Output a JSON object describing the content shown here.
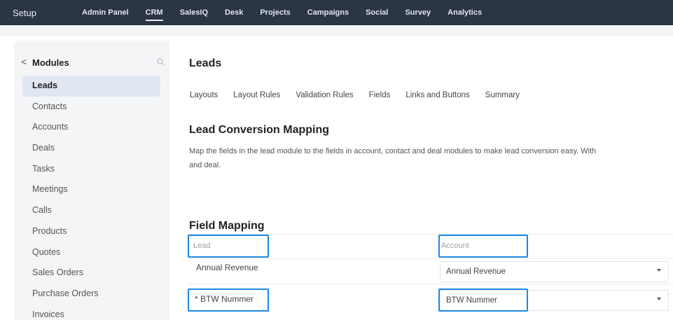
{
  "topbar": {
    "setup_label": "Setup",
    "nav": [
      {
        "label": "Admin Panel",
        "active": false
      },
      {
        "label": "CRM",
        "active": true
      },
      {
        "label": "SalesIQ",
        "active": false
      },
      {
        "label": "Desk",
        "active": false
      },
      {
        "label": "Projects",
        "active": false
      },
      {
        "label": "Campaigns",
        "active": false
      },
      {
        "label": "Social",
        "active": false
      },
      {
        "label": "Survey",
        "active": false
      },
      {
        "label": "Analytics",
        "active": false
      }
    ]
  },
  "sidebar": {
    "back_glyph": "<",
    "title": "Modules",
    "search_icon": "search-icon",
    "items": [
      {
        "label": "Leads",
        "active": true
      },
      {
        "label": "Contacts"
      },
      {
        "label": "Accounts"
      },
      {
        "label": "Deals"
      },
      {
        "label": "Tasks"
      },
      {
        "label": "Meetings"
      },
      {
        "label": "Calls"
      },
      {
        "label": "Products"
      },
      {
        "label": "Quotes"
      },
      {
        "label": "Sales Orders"
      },
      {
        "label": "Purchase Orders"
      },
      {
        "label": "Invoices"
      }
    ]
  },
  "main": {
    "title": "Leads",
    "tabs": [
      "Layouts",
      "Layout Rules",
      "Validation Rules",
      "Fields",
      "Links and Buttons",
      "Summary"
    ],
    "section_title": "Lead Conversion Mapping",
    "description_line1": "Map the fields in the lead module to the fields in account, contact and deal modules to make lead conversion easy. With",
    "description_line2": "and deal.",
    "field_mapping": {
      "title": "Field Mapping",
      "head_lead_placeholder": "Lead",
      "head_account_placeholder": "Account",
      "rows": [
        {
          "lead": "Annual Revenue",
          "account": "Annual Revenue"
        },
        {
          "lead": "* BTW Nummer",
          "account": "BTW Nummer"
        }
      ]
    },
    "highlight_color": "#1e88e5"
  }
}
